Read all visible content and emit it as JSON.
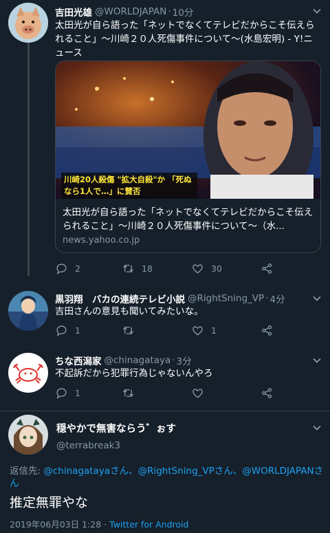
{
  "tweets": [
    {
      "name": "吉田光雄",
      "handle": "@WORLDJAPAN",
      "time": "10分",
      "text": "太田光が自ら語った「ネットでなくてテレビだからこそ伝えられること」〜川崎２０人死傷事件について〜(水島宏明) - Y!ニュース",
      "card": {
        "image_caption": "川崎20人殺傷 \"拡大自殺\"か 「死ぬなら1人で…」に賛否",
        "title": "太田光が自ら語った「ネットでなくてテレビだからこそ伝えられること」〜川崎２０人死傷事件について〜（水...",
        "domain": "news.yahoo.co.jp"
      },
      "reply_count": "2",
      "retweet_count": "18",
      "like_count": "30"
    },
    {
      "name": "黒羽翔　バカの連続テレビ小説",
      "handle": "@RightSning_VP",
      "time": "4分",
      "text": "吉田さんの意見も聞いてみたいな。",
      "reply_count": "1",
      "retweet_count": "",
      "like_count": "1"
    },
    {
      "name": "ちな西潟家",
      "handle": "@chinagataya",
      "time": "3分",
      "text": "不起訴だから犯罪行為じゃないんやろ",
      "reply_count": "1",
      "retweet_count": "",
      "like_count": ""
    }
  ],
  "main": {
    "name": "穏やかで無害ならう゛ぉす",
    "handle": "@terrabreak3",
    "replying_label": "返信先:",
    "replying_to": "@chinagatayaさん、@RightSning_VPさん、@WORLDJAPANさん",
    "text": "推定無罪やな",
    "timestamp": "2019年06月03日 1:28",
    "dot": "·",
    "client": "Twitter for Android"
  },
  "icons": {
    "reply": "reply-icon",
    "retweet": "retweet-icon",
    "like": "heart-icon",
    "share": "share-icon",
    "menu": "chevron-down-icon"
  },
  "colors": {
    "background": "#15202b",
    "secondary_text": "#8899a6",
    "link": "#1da1f2",
    "border": "#38444d"
  }
}
